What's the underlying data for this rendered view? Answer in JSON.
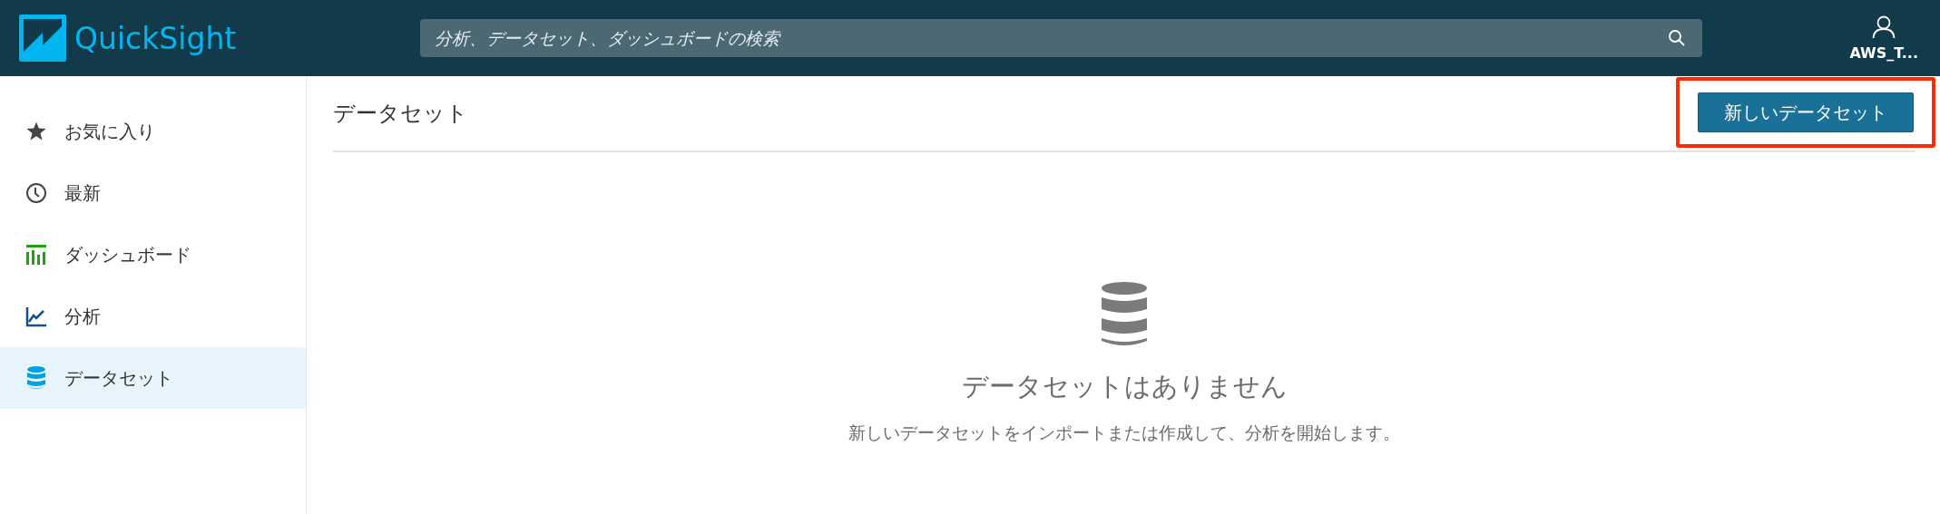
{
  "header": {
    "logo_text": "QuickSight",
    "search": {
      "placeholder": "分析、データセット、ダッシュボードの検索"
    },
    "user": "AWS_T..."
  },
  "sidebar": {
    "items": [
      {
        "label": "お気に入り",
        "kind": "star",
        "selected": false
      },
      {
        "label": "最新",
        "kind": "clock",
        "selected": false
      },
      {
        "label": "ダッシュボード",
        "kind": "dashboard",
        "selected": false
      },
      {
        "label": "分析",
        "kind": "analysis",
        "selected": false
      },
      {
        "label": "データセット",
        "kind": "dataset",
        "selected": true
      }
    ]
  },
  "main": {
    "title": "データセット",
    "new_button": {
      "label": "新しいデータセット",
      "highlighted": true
    },
    "empty_state": {
      "heading": "データセットはありません",
      "message": "新しいデータセットをインポートまたは作成して、分析を開始します。"
    }
  }
}
